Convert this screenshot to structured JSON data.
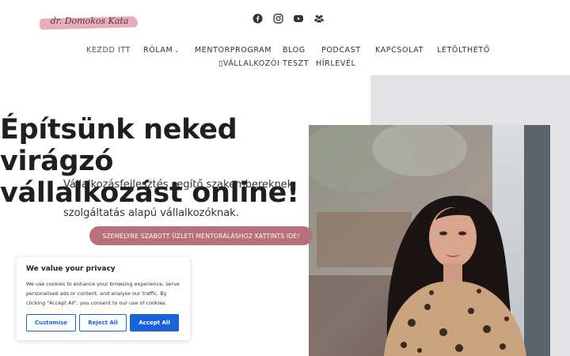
{
  "header": {
    "logo_text": "dr. Domokos Kata",
    "social_icons": [
      "facebook-icon",
      "instagram-icon",
      "youtube-icon",
      "group-icon"
    ]
  },
  "nav": {
    "items": [
      {
        "label": "KEZDD ITT"
      },
      {
        "label": "RÓLAM"
      },
      {
        "label": "MENTORPROGRAM"
      },
      {
        "label": "BLOG"
      },
      {
        "label": "PODCAST"
      },
      {
        "label": "KAPCSOLAT"
      },
      {
        "label": "LETÖLTHETŐ"
      },
      {
        "label": "VÁLLALKOZÓI TESZT"
      },
      {
        "label": "HÍRLEVÉL"
      }
    ]
  },
  "hero": {
    "headline_line1": "Építsünk neked virágzó",
    "headline_line2": "vállalkozást online!",
    "sub_line1": "Vállalkozásfejlesztés segítő szakembereknek,",
    "sub_line2": "szolgáltatás alapú vállalkozóknak.",
    "cta_label": "SZEMÉLYRE SZABOTT ÜZLETI MENTORÁLÁSHOZ KATTINTS IDE!"
  },
  "cookie": {
    "title": "We value your privacy",
    "text": "We use cookies to enhance your browsing experience, serve personalised ads or content, and analyse our traffic. By clicking \"Accept All\", you consent to our use of cookies.",
    "customise_label": "Customise",
    "reject_label": "Reject All",
    "accept_label": "Accept All"
  },
  "colors": {
    "brand_pink": "#b7707c",
    "logo_swash": "#e7aeb8",
    "cookie_blue": "#1863dc",
    "hero_grey": "#e3e3e5"
  }
}
